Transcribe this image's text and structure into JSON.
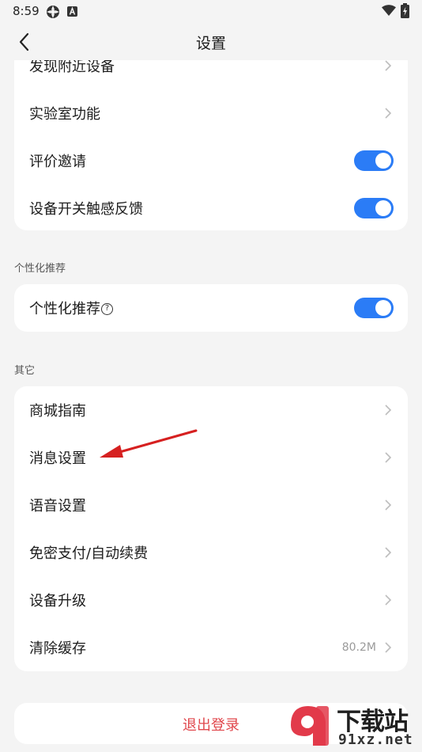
{
  "status_bar": {
    "time": "8:59",
    "icons": [
      "settings-app-icon",
      "font-a-icon",
      "wifi-icon",
      "battery-charging-icon"
    ]
  },
  "header": {
    "title": "设置",
    "back_icon": "chevron-left-icon"
  },
  "card_top": {
    "items": [
      {
        "label": "发现附近设备",
        "control": "chevron"
      },
      {
        "label": "实验室功能",
        "control": "chevron"
      },
      {
        "label": "评价邀请",
        "control": "toggle",
        "on": true
      },
      {
        "label": "设备开关触感反馈",
        "control": "toggle",
        "on": true
      }
    ]
  },
  "section_personal": {
    "title": "个性化推荐",
    "items": [
      {
        "label": "个性化推荐",
        "control": "toggle",
        "on": true,
        "help_icon": "question-circle-icon",
        "help_glyph": "?"
      }
    ]
  },
  "section_other": {
    "title": "其它",
    "items": [
      {
        "label": "商城指南",
        "control": "chevron"
      },
      {
        "label": "消息设置",
        "control": "chevron"
      },
      {
        "label": "语音设置",
        "control": "chevron"
      },
      {
        "label": "免密支付/自动续费",
        "control": "chevron"
      },
      {
        "label": "设备升级",
        "control": "chevron"
      },
      {
        "label": "清除缓存",
        "control": "chevron",
        "value": "80.2M"
      }
    ]
  },
  "logout": {
    "label": "退出登录"
  },
  "watermark": {
    "text": "下载站",
    "url": "91xz.net"
  },
  "colors": {
    "background": "#f4f4f4",
    "card": "#ffffff",
    "toggle_on": "#2b7cf6",
    "logout_text": "#e0474c",
    "annotation_arrow": "#d62020"
  }
}
